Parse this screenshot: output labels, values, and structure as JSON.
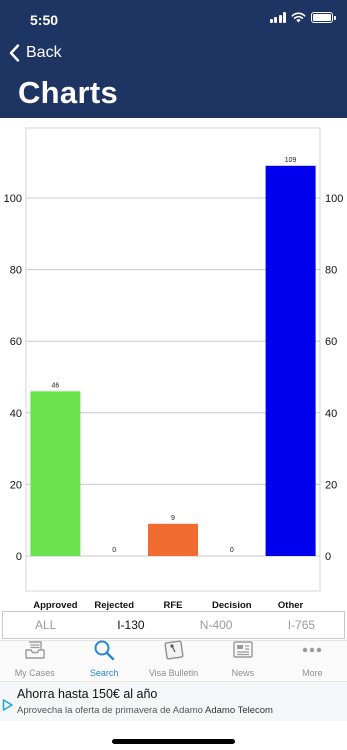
{
  "status_bar": {
    "time": "5:50"
  },
  "nav": {
    "back_label": "Back",
    "title": "Charts"
  },
  "chart_data": {
    "type": "bar",
    "categories": [
      "Approved",
      "Rejected",
      "RFE",
      "Decision",
      "Other"
    ],
    "values": [
      46,
      0,
      9,
      0,
      109
    ],
    "data_labels": [
      "46",
      "0",
      "9",
      "0",
      "109"
    ],
    "colors": [
      "#6be24b",
      "#6be24b",
      "#ef6b30",
      "#ef6b30",
      "#0000ee"
    ],
    "y_ticks": [
      "0",
      "20",
      "40",
      "60",
      "80",
      "100"
    ],
    "ylim": [
      -5,
      120
    ],
    "grid": true,
    "title": "",
    "xlabel": "",
    "ylabel": ""
  },
  "segments": {
    "items": [
      "ALL",
      "I-130",
      "N-400",
      "I-765"
    ],
    "selected": "I-130"
  },
  "tabbar": {
    "items": [
      {
        "label": "My Cases",
        "icon": "inbox-icon"
      },
      {
        "label": "Search",
        "icon": "search-icon"
      },
      {
        "label": "Visa Bulletin",
        "icon": "bulletin-icon"
      },
      {
        "label": "News",
        "icon": "news-icon"
      },
      {
        "label": "More",
        "icon": "more-icon"
      }
    ],
    "active": "Search"
  },
  "ad": {
    "title": "Ahorra hasta 150€ al año",
    "text": "Aprovecha la oferta de primavera de Adamo",
    "brand": "Adamo Telecom"
  },
  "colors": {
    "header": "#1e3463",
    "accent": "#2a84d6"
  }
}
